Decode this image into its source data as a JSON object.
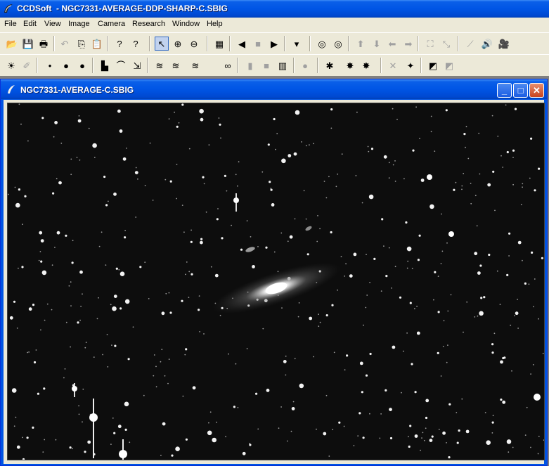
{
  "app": {
    "title": "CCDSoft  - NGC7331-AVERAGE-DDP-SHARP-C.SBIG"
  },
  "menu": [
    "File",
    "Edit",
    "View",
    "Image",
    "Camera",
    "Research",
    "Window",
    "Help"
  ],
  "toolbar1": [
    {
      "name": "open-icon",
      "glyph": "📂"
    },
    {
      "name": "save-icon",
      "glyph": "💾"
    },
    {
      "name": "print-icon",
      "glyph": "🖶"
    },
    {
      "name": "undo-icon",
      "glyph": "↶",
      "dim": true
    },
    {
      "name": "copy-icon",
      "glyph": "⎘"
    },
    {
      "name": "paste-icon",
      "glyph": "📋"
    },
    {
      "name": "help-icon",
      "glyph": "?"
    },
    {
      "name": "context-help-icon",
      "glyph": "?"
    },
    {
      "name": "pointer-icon",
      "glyph": "↖",
      "pressed": true
    },
    {
      "name": "zoom-in-icon",
      "glyph": "⊕"
    },
    {
      "name": "zoom-out-icon",
      "glyph": "⊖"
    },
    {
      "name": "grid-icon",
      "glyph": "▦"
    },
    {
      "name": "prev-icon",
      "glyph": "◀"
    },
    {
      "name": "stop-icon",
      "glyph": "■",
      "dim": true
    },
    {
      "name": "next-icon",
      "glyph": "▶"
    },
    {
      "name": "filter-icon",
      "glyph": "▾"
    },
    {
      "name": "target-icon",
      "glyph": "◎"
    },
    {
      "name": "double-target-icon",
      "glyph": "◎"
    },
    {
      "name": "arrow-up-icon",
      "glyph": "⬆",
      "dim": true
    },
    {
      "name": "arrow-down-icon",
      "glyph": "⬇",
      "dim": true
    },
    {
      "name": "arrow-left-icon",
      "glyph": "⬅",
      "dim": true
    },
    {
      "name": "arrow-right-icon",
      "glyph": "➡",
      "dim": true
    },
    {
      "name": "expand-icon",
      "glyph": "⛶",
      "dim": true
    },
    {
      "name": "shrink-icon",
      "glyph": "⤡",
      "dim": true
    },
    {
      "name": "telescope-icon",
      "glyph": "⟋",
      "dim": true
    },
    {
      "name": "speaker-icon",
      "glyph": "🔊",
      "dim": true
    },
    {
      "name": "camera-icon",
      "glyph": "🎥",
      "dim": true
    }
  ],
  "toolbar2": [
    {
      "name": "brightness-icon",
      "glyph": "☀"
    },
    {
      "name": "wand-icon",
      "glyph": "✐",
      "dim": true
    },
    {
      "name": "star-small-icon",
      "glyph": "•"
    },
    {
      "name": "star-medium-icon",
      "glyph": "●"
    },
    {
      "name": "star-large-icon",
      "glyph": "●"
    },
    {
      "name": "histogram-icon",
      "glyph": "▙"
    },
    {
      "name": "curve-icon",
      "glyph": "⌒"
    },
    {
      "name": "levels-icon",
      "glyph": "⇲"
    },
    {
      "name": "layers-a-icon",
      "glyph": "≋"
    },
    {
      "name": "layers-b-icon",
      "glyph": "≋"
    },
    {
      "name": "layers-color-icon",
      "glyph": "≋"
    },
    {
      "name": "layers-link-icon",
      "glyph": "∞"
    },
    {
      "name": "gray-bar-icon",
      "glyph": "▮",
      "dim": true
    },
    {
      "name": "gray-square-icon",
      "glyph": "■",
      "dim": true
    },
    {
      "name": "rgb-icon",
      "glyph": "▥"
    },
    {
      "name": "circle-icon",
      "glyph": "●",
      "dim": true
    },
    {
      "name": "sharpen-a-icon",
      "glyph": "✱"
    },
    {
      "name": "sharpen-b-icon",
      "glyph": "✸"
    },
    {
      "name": "sharpen-c-icon",
      "glyph": "✸"
    },
    {
      "name": "cancel-x-icon",
      "glyph": "✕",
      "dim": true
    },
    {
      "name": "stars-icon",
      "glyph": "✦"
    },
    {
      "name": "diag-a-icon",
      "glyph": "◩"
    },
    {
      "name": "diag-b-icon",
      "glyph": "◩",
      "dim": true
    }
  ],
  "child_window": {
    "title": "NGC7331-AVERAGE-C.SBIG",
    "minimize": "_",
    "maximize": "□",
    "close": "✕"
  }
}
